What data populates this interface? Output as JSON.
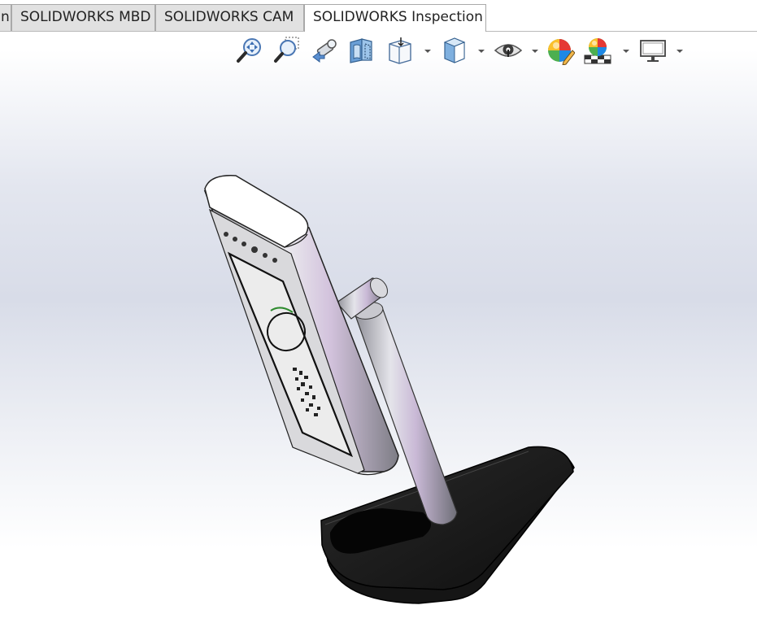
{
  "tabs": [
    {
      "label": "n"
    },
    {
      "label": "SOLIDWORKS MBD"
    },
    {
      "label": "SOLIDWORKS CAM"
    },
    {
      "label": "SOLIDWORKS Inspection",
      "active": true
    }
  ],
  "view_toolbar": {
    "icons": [
      "zoom-to-fit-icon",
      "zoom-to-area-icon",
      "previous-view-icon",
      "section-view-icon",
      "view-orientation-icon",
      "display-style-icon",
      "hide-show-items-icon",
      "edit-appearance-icon",
      "apply-scene-icon",
      "view-settings-icon"
    ]
  },
  "model": {
    "name": "display-stand-assembly",
    "colors": {
      "device_body": "#d6d6d6",
      "screen": "#ececec",
      "pole": "#b9b9c0",
      "base": "#1c1c1c"
    }
  }
}
